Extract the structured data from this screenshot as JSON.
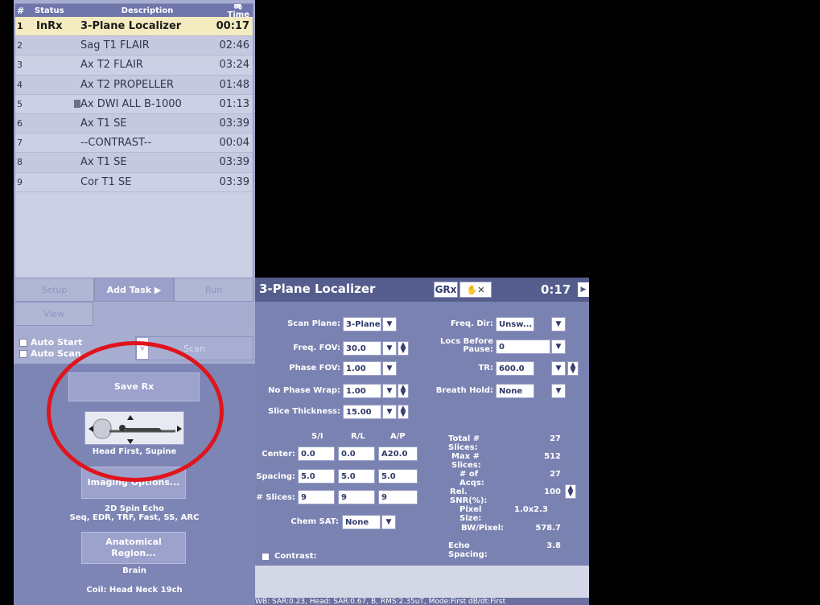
{
  "list": {
    "headers": {
      "num": "#",
      "status": "Status",
      "description": "Description",
      "time": "Time"
    },
    "rows": [
      {
        "num": "1",
        "status": "InRx",
        "desc": "3-Plane Localizer",
        "time": "00:17",
        "selected": true
      },
      {
        "num": "2",
        "status": "",
        "desc": "Sag T1 FLAIR",
        "time": "02:46"
      },
      {
        "num": "3",
        "status": "",
        "desc": "Ax T2 FLAIR",
        "time": "03:24"
      },
      {
        "num": "4",
        "status": "",
        "desc": "Ax T2 PROPELLER",
        "time": "01:48"
      },
      {
        "num": "5",
        "status": "",
        "desc": "Ax DWI ALL B-1000",
        "time": "01:13"
      },
      {
        "num": "6",
        "status": "",
        "desc": "Ax T1 SE",
        "time": "03:39"
      },
      {
        "num": "7",
        "status": "",
        "desc": "--CONTRAST--",
        "time": "00:04"
      },
      {
        "num": "8",
        "status": "",
        "desc": "Ax T1 SE",
        "time": "03:39"
      },
      {
        "num": "9",
        "status": "",
        "desc": "Cor T1 SE",
        "time": "03:39"
      }
    ]
  },
  "buttons": {
    "setup": "Setup",
    "add_task": "Add Task",
    "run": "Run",
    "view": "View",
    "scan": "Scan"
  },
  "auto": {
    "start": "Auto Start",
    "scan": "Auto Scan"
  },
  "lower": {
    "save_rx": "Save Rx",
    "position": "Head First, Supine",
    "imaging_options": "Imaging Options...",
    "seq1": "2D Spin Echo",
    "seq2": "Seq, EDR, TRF, Fast, SS, ARC",
    "anatomical": "Anatomical Region...",
    "region": "Brain",
    "coil": "Coil: Head Neck 19ch"
  },
  "proto": {
    "title": "3-Plane Localizer",
    "grx": "GRx",
    "time": "0:17",
    "left": {
      "scan_plane": {
        "label": "Scan Plane:",
        "value": "3-Plane"
      },
      "freq_fov": {
        "label": "Freq. FOV:",
        "value": "30.0"
      },
      "phase_fov": {
        "label": "Phase FOV:",
        "value": "1.00"
      },
      "no_phase_wrap": {
        "label": "No Phase Wrap:",
        "value": "1.00"
      },
      "slice_thickness": {
        "label": "Slice Thickness:",
        "value": "15.00"
      }
    },
    "right": {
      "freq_dir": {
        "label": "Freq. Dir:",
        "value": "Unsw..."
      },
      "locs_before_pause": {
        "label": "Locs Before Pause:",
        "value": "0"
      },
      "tr": {
        "label": "TR:",
        "value": "600.0"
      },
      "breath_hold": {
        "label": "Breath Hold:",
        "value": "None"
      }
    },
    "grid": {
      "cols": [
        "S/I",
        "R/L",
        "A/P"
      ],
      "rows": [
        {
          "label": "Center:",
          "values": [
            "0.0",
            "0.0",
            "A20.0"
          ]
        },
        {
          "label": "Spacing:",
          "values": [
            "5.0",
            "5.0",
            "5.0"
          ]
        },
        {
          "label": "# Slices:",
          "values": [
            "9",
            "9",
            "9"
          ]
        }
      ]
    },
    "chem_sat": {
      "label": "Chem SAT:",
      "value": "None"
    },
    "stats": [
      {
        "label": "Total # Slices:",
        "value": "27"
      },
      {
        "label": "Max # Slices:",
        "value": "512"
      },
      {
        "label": "# of Acqs:",
        "value": "27"
      },
      {
        "label": "Rel. SNR(%):",
        "value": "100"
      },
      {
        "label": "Pixel Size:",
        "value": "1.0x2.3"
      },
      {
        "label": "BW/Pixel:",
        "value": "578.7"
      },
      {
        "label": "Echo Spacing:",
        "value": "3.8"
      }
    ],
    "contrast": "Contrast:",
    "status": "WB: SAR:0.23, Head: SAR:0.67, B, RMS:2.35uT, Mode:First          dB/dt:First"
  }
}
